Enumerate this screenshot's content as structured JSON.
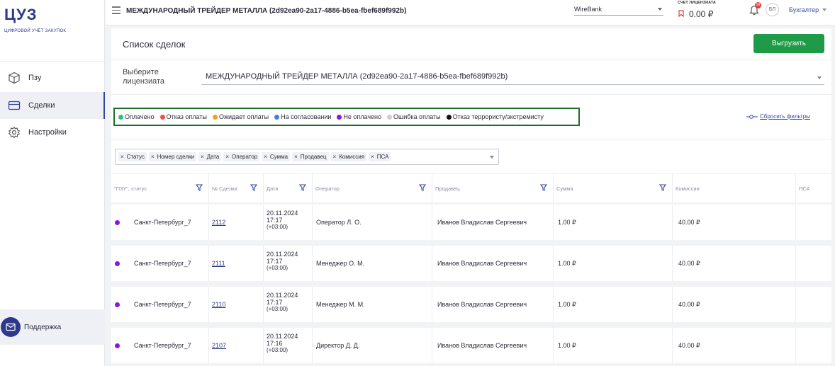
{
  "app": {
    "logo": "ЦУЗ",
    "logo_sub": "ЦИФРОВОЙ УЧЁТ ЗАКУПОК"
  },
  "sidebar": {
    "items": [
      {
        "label": "Пзу",
        "icon": "box-icon"
      },
      {
        "label": "Сделки",
        "icon": "card-icon",
        "active": true
      },
      {
        "label": "Настройки",
        "icon": "gear-icon"
      }
    ],
    "support_label": "Поддержка"
  },
  "topbar": {
    "title": "МЕЖДУНАРОДНЫЙ ТРЕЙДЕР МЕТАЛЛА (2d92ea90-2a17-4886-b5ea-fbef689f992b)",
    "bank_select": "WireBank",
    "account_label": "СЧЕТ ЛИЦЕНЗИАТА",
    "account_value": "0.00 ₽",
    "notification_count": "99",
    "avatar_initials": "БЛ",
    "role": "Бухгалтер"
  },
  "page": {
    "title": "Список сделок",
    "export_label": "Выгрузить",
    "licensee_label": "Выберите лицензиата",
    "licensee_value": "МЕЖДУНАРОДНЫЙ ТРЕЙДЕР МЕТАЛЛА (2d92ea90-2a17-4886-b5ea-fbef689f992b)",
    "reset_filters": "Сбросить фильтры"
  },
  "legend": [
    {
      "label": "Оплачено",
      "color": "#2ec27e"
    },
    {
      "label": "Отказ оплаты",
      "color": "#e8534a"
    },
    {
      "label": "Ожидает оплаты",
      "color": "#f0a030"
    },
    {
      "label": "На согласовании",
      "color": "#3c7fe0"
    },
    {
      "label": "Не оплачено",
      "color": "#8a18d8"
    },
    {
      "label": "Ошибка оплаты",
      "color": "#cfcfcf"
    },
    {
      "label": "Отказ террористу/экстремисту",
      "color": "#111111"
    }
  ],
  "column_tags": [
    "Статус",
    "Номер сделки",
    "Дата",
    "Оператор",
    "Сумма",
    "Продавец",
    "Комиссия",
    "ПСА"
  ],
  "table": {
    "headers": {
      "status": "\"ПЗУ\", статус",
      "number": "№ Сделки",
      "date": "Дата",
      "operator": "Оператор",
      "seller": "Продавец",
      "sum": "Сумма",
      "commission": "Комиссия",
      "psa": "ПСА"
    },
    "rows": [
      {
        "pzu": "Санкт-Петербург_7",
        "number": "2112",
        "date": "20.11.2024",
        "time": "17:17",
        "tz": "(+03:00)",
        "operator": "Оператор Л. О.",
        "seller": "Иванов Владислав Сергеевич",
        "sum": "1.00 ₽",
        "commission": "40.00 ₽"
      },
      {
        "pzu": "Санкт-Петербург_7",
        "number": "2111",
        "date": "20.11.2024",
        "time": "17:17",
        "tz": "(+03:00)",
        "operator": "Менеджер О. М.",
        "seller": "Иванов Владислав Сергеевич",
        "sum": "1.00 ₽",
        "commission": "40.00 ₽"
      },
      {
        "pzu": "Санкт-Петербург_7",
        "number": "2110",
        "date": "20.11.2024",
        "time": "17:17",
        "tz": "(+03:00)",
        "operator": "Менеджер М. М.",
        "seller": "Иванов Владислав Сергеевич",
        "sum": "1.00 ₽",
        "commission": "40.00 ₽"
      },
      {
        "pzu": "Санкт-Петербург_7",
        "number": "2107",
        "date": "20.11.2024",
        "time": "17:16",
        "tz": "(+03:00)",
        "operator": "Директор Д. Д.",
        "seller": "Иванов Владислав Сергеевич",
        "sum": "1.00 ₽",
        "commission": "40.00 ₽"
      }
    ]
  }
}
